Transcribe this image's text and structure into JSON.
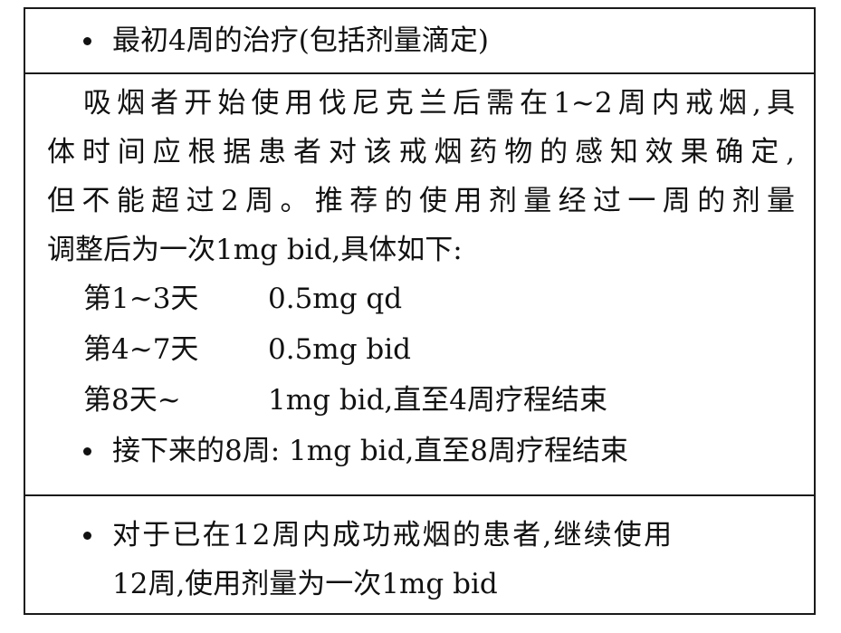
{
  "section1": {
    "bullet": "最初4周的治疗(包括剂量滴定)"
  },
  "section2": {
    "paragraph_lines": [
      "吸烟者开始使用伐尼克兰后需在1~2周内戒烟,具",
      "体时间应根据患者对该戒烟药物的感知效果确定,",
      "但不能超过2周。推荐的使用剂量经过一周的剂量",
      "调整后为一次1mg bid,具体如下:"
    ],
    "doses": [
      {
        "day": "第1~3天",
        "dose": "0.5mg qd"
      },
      {
        "day": "第4~7天",
        "dose": "0.5mg bid"
      },
      {
        "day": "第8天~",
        "dose": "1mg bid,直至4周疗程结束"
      }
    ],
    "bullet": "接下来的8周: 1mg bid,直至8周疗程结束"
  },
  "section3": {
    "bullet_line1": "对于已在12周内成功戒烟的患者,继续使用",
    "bullet_line2": "12周,使用剂量为一次1mg bid"
  }
}
